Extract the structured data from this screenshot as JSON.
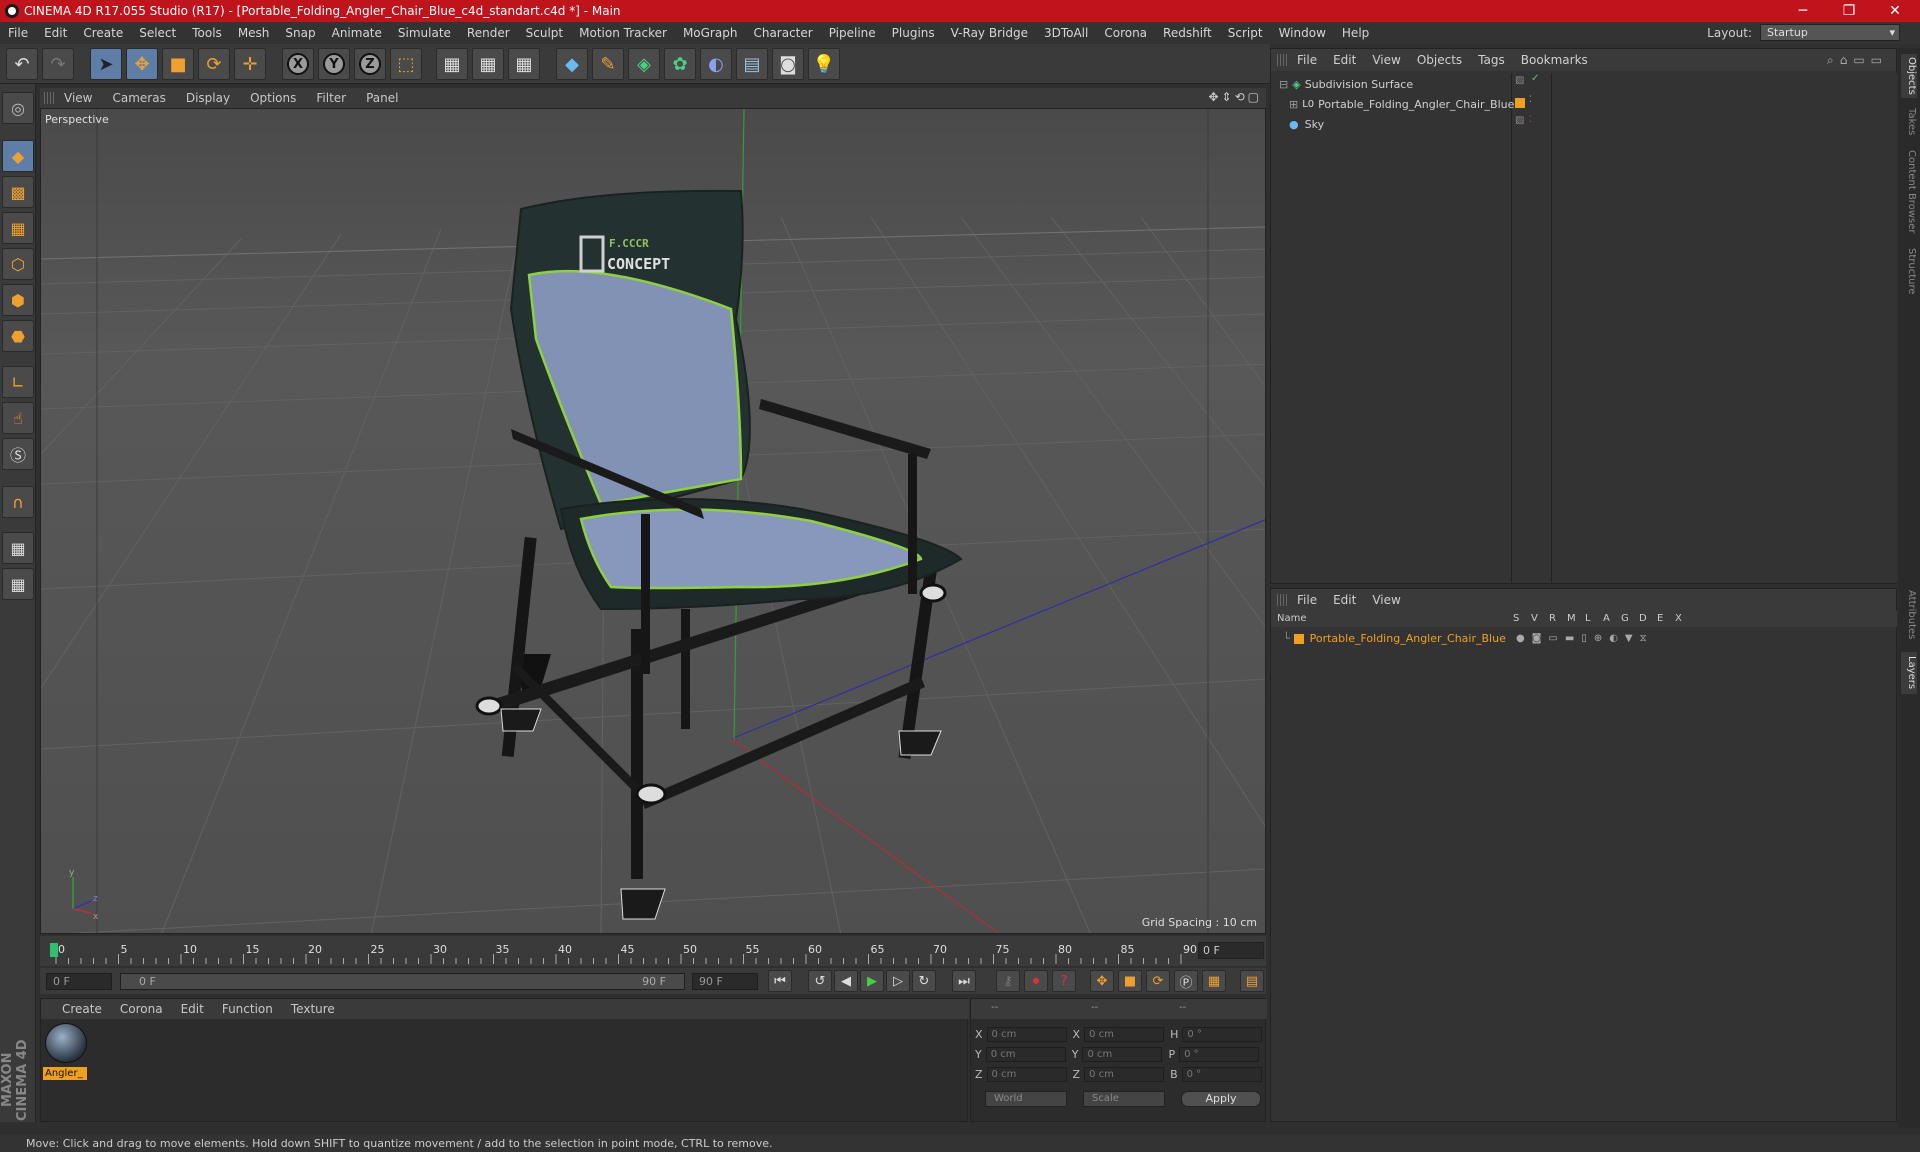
{
  "title_bar": {
    "title": "CINEMA 4D R17.055 Studio (R17) - [Portable_Folding_Angler_Chair_Blue_c4d_standart.c4d *] - Main",
    "minimize": "─",
    "maximize": "❐",
    "close": "✕"
  },
  "menu": [
    "File",
    "Edit",
    "Create",
    "Select",
    "Tools",
    "Mesh",
    "Snap",
    "Animate",
    "Simulate",
    "Render",
    "Sculpt",
    "Motion Tracker",
    "MoGraph",
    "Character",
    "Pipeline",
    "Plugins",
    "V-Ray Bridge",
    "3DToAll",
    "Corona",
    "Redshift",
    "Script",
    "Window",
    "Help"
  ],
  "layout": {
    "label": "Layout:",
    "value": "Startup"
  },
  "toolbar": {
    "axis_x": "X",
    "axis_y": "Y",
    "axis_z": "Z"
  },
  "viewport": {
    "menu": [
      "View",
      "Cameras",
      "Display",
      "Options",
      "Filter",
      "Panel"
    ],
    "label": "Perspective",
    "grid_spacing": "Grid Spacing : 10 cm",
    "nav_icons": "✥⇕⟲▢"
  },
  "chair_logo": {
    "line1": "F.CCCR",
    "line2": "CONCEPT"
  },
  "timeline": {
    "ticks": [
      "0",
      "5",
      "10",
      "15",
      "20",
      "25",
      "30",
      "35",
      "40",
      "45",
      "50",
      "55",
      "60",
      "65",
      "70",
      "75",
      "80",
      "85",
      "90"
    ],
    "current_frame": "0 F",
    "start": "0 F",
    "slider_start": "0 F",
    "slider_end": "90 F",
    "end": "90 F"
  },
  "material_panel": {
    "menu": [
      "Create",
      "Corona",
      "Edit",
      "Function",
      "Texture"
    ],
    "material_name": "Angler_"
  },
  "coord_panel": {
    "headers": [
      "--",
      "--",
      "--"
    ],
    "rows": [
      {
        "a": "X",
        "av": "0 cm",
        "b": "X",
        "bv": "0 cm",
        "c": "H",
        "cv": "0 °"
      },
      {
        "a": "Y",
        "av": "0 cm",
        "b": "Y",
        "bv": "0 cm",
        "c": "P",
        "cv": "0 °"
      },
      {
        "a": "Z",
        "av": "0 cm",
        "b": "Z",
        "bv": "0 cm",
        "c": "B",
        "cv": "0 °"
      }
    ],
    "world": "World",
    "scale": "Scale",
    "apply": "Apply"
  },
  "object_manager": {
    "menu": [
      "File",
      "Edit",
      "View",
      "Objects",
      "Tags",
      "Bookmarks"
    ],
    "objects": [
      "Subdivision Surface",
      "Portable_Folding_Angler_Chair_Blue",
      "Sky"
    ]
  },
  "layer_manager": {
    "menu": [
      "File",
      "Edit",
      "View"
    ],
    "columns": [
      "Name",
      "S",
      "V",
      "R",
      "M",
      "L",
      "A",
      "G",
      "D",
      "E",
      "X"
    ],
    "layers": [
      "Portable_Folding_Angler_Chair_Blue"
    ],
    "layer_color": "#f0a020"
  },
  "side_tabs": [
    "Objects",
    "Takes",
    "Content Browser",
    "Structure",
    "Attributes",
    "Layers"
  ],
  "status": "Move: Click and drag to move elements. Hold down SHIFT to quantize movement / add to the selection in point mode, CTRL to remove.",
  "brand": "MAXON CINEMA 4D",
  "colors": {
    "title_red": "#c0141d",
    "accent_orange": "#f0a030",
    "selected_blue": "#5e7ea8"
  }
}
